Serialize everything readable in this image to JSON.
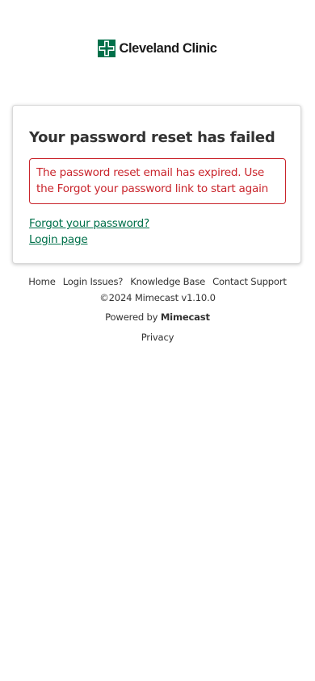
{
  "logo": {
    "text": "Cleveland Clinic",
    "mark_color": "#00704a"
  },
  "card": {
    "title": "Your password reset has failed",
    "error_message": "The password reset email has expired. Use the Forgot your password link to start again",
    "links": {
      "forgot_password": "Forgot your password?",
      "login_page": "Login page"
    }
  },
  "footer": {
    "nav": {
      "home": "Home",
      "login_issues": "Login Issues?",
      "knowledge_base": "Knowledge Base",
      "contact_support": "Contact Support"
    },
    "copyright": "©2024 Mimecast v1.10.0",
    "powered_by_prefix": "Powered by",
    "powered_by_brand": "Mimecast",
    "privacy": "Privacy"
  },
  "colors": {
    "link": "#00704a",
    "error": "#c9252c",
    "text": "#333333"
  }
}
